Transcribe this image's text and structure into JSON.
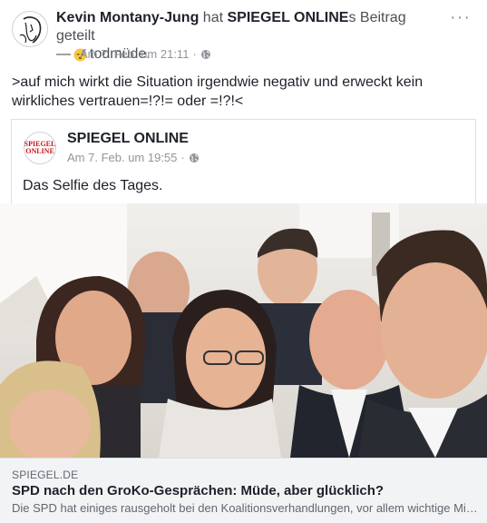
{
  "post": {
    "author": "Kevin Montany-Jung",
    "action": "hat",
    "shared_page": "SPIEGEL ONLINE",
    "possessive_suffix": "s Beitrag geteilt",
    "feeling_prefix": "—",
    "feeling": "todmüde.",
    "feeling_icon": "sleepy-face-emoji",
    "timestamp": "Am 7. Feb. um 21:11",
    "separator": "·",
    "privacy_icon": "globe-icon",
    "more_label": "···",
    "text": ">auf mich wirkt die Situation irgendwie negativ und erweckt kein wirkliches vertrauen=!?!= oder =!?!<"
  },
  "shared": {
    "page_name": "SPIEGEL ONLINE",
    "logo_line1": "SPIEGEL",
    "logo_line2": "ONLINE",
    "timestamp": "Am 7. Feb. um 19:55",
    "separator": "·",
    "text": "Das Selfie des Tages."
  },
  "link": {
    "domain": "SPIEGEL.DE",
    "title": "SPD nach den GroKo-Gesprächen: Müde, aber glücklich?",
    "description": "Die SPD hat einiges rausgeholt bei den Koalitionsverhandlungen, vor allem wichtige Mini..."
  },
  "colors": {
    "text_primary": "#1d2129",
    "text_secondary": "#90949c",
    "link_bg": "#f2f3f5",
    "spiegel_red": "#c4161c"
  }
}
